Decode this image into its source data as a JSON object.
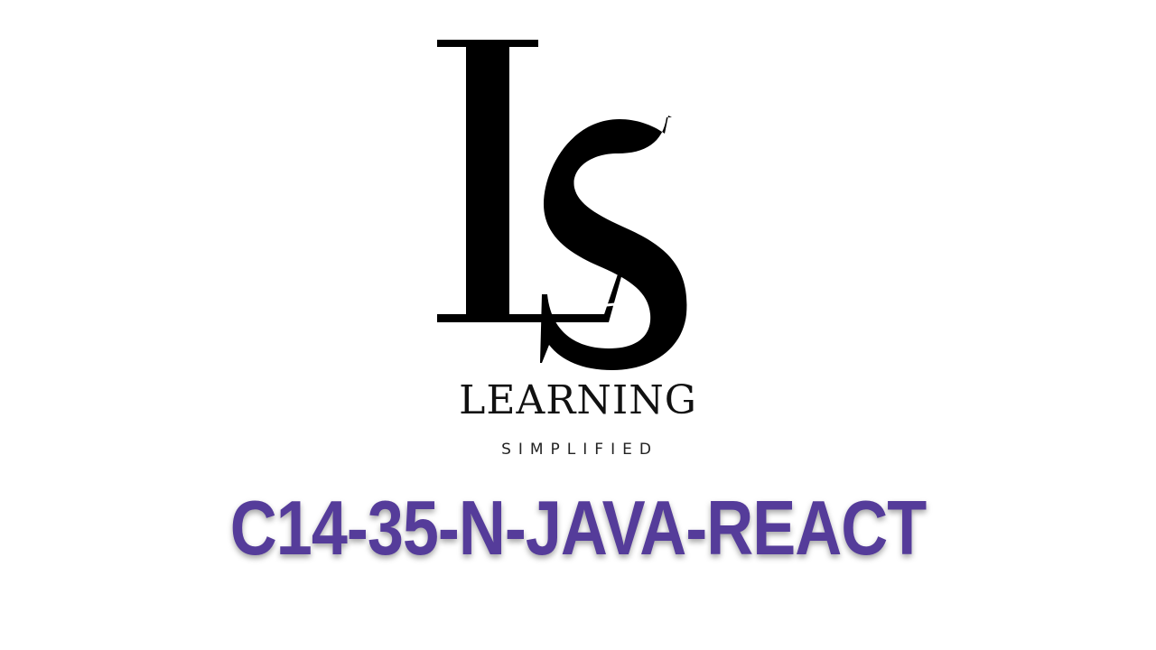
{
  "logo": {
    "monogram": "LS",
    "name": "LEARNING",
    "tagline": "SIMPLIFIED",
    "mark_color": "#000000"
  },
  "course": {
    "code": "C14-35-N-JAVA-REACT",
    "color": "#553c9a"
  }
}
